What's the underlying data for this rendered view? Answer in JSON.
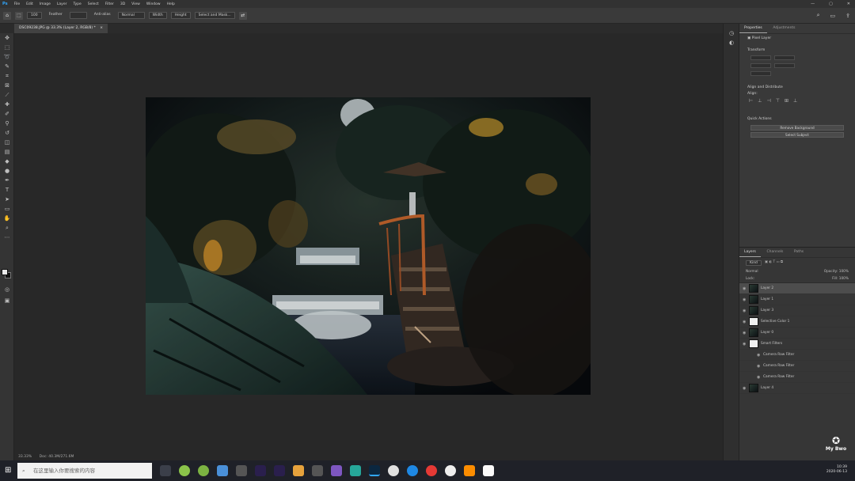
{
  "app": {
    "name": "Adobe Photoshop"
  },
  "menu": [
    "File",
    "Edit",
    "Image",
    "Layer",
    "Type",
    "Select",
    "Filter",
    "3D",
    "View",
    "Window",
    "Help"
  ],
  "options": {
    "size": "100",
    "feather": "Feather",
    "anti_alias": "Anti-alias",
    "style": "Normal",
    "width": "Width",
    "height": "Height",
    "select_mask": "Select and Mask..."
  },
  "document": {
    "tab_title": "DSC09238.JPG @ 33.3% (Layer 2, RGB/8) *"
  },
  "properties": {
    "tabs": [
      "Properties",
      "Adjustments"
    ],
    "kind": "Pixel Layer",
    "transform_label": "Transform",
    "align_label": "Align and Distribute",
    "align_sub": "Align:",
    "quick_actions_label": "Quick Actions",
    "remove_bg": "Remove Background",
    "select_subject": "Select Subject"
  },
  "layers_panel": {
    "tabs": [
      "Layers",
      "Channels",
      "Paths"
    ],
    "kind_filter": "Kind",
    "blend_mode": "Normal",
    "opacity": "Opacity: 100%",
    "lock": "Lock:",
    "fill": "Fill: 100%",
    "layers": [
      {
        "name": "Layer 2",
        "thumb": "photo",
        "selected": true
      },
      {
        "name": "Layer 1",
        "thumb": "photo",
        "selected": false
      },
      {
        "name": "Layer 3",
        "thumb": "photo",
        "selected": false
      },
      {
        "name": "Selective Color 1",
        "thumb": "white",
        "selected": false
      },
      {
        "name": "Layer 0",
        "thumb": "photo",
        "selected": false
      },
      {
        "name": "Smart Filters",
        "thumb": "white",
        "selected": false
      },
      {
        "name": "Camera Raw Filter",
        "thumb": "none",
        "selected": false
      },
      {
        "name": "Camera Raw Filter",
        "thumb": "none",
        "selected": false
      },
      {
        "name": "Camera Raw Filter",
        "thumb": "none",
        "selected": false
      },
      {
        "name": "Layer 4",
        "thumb": "photo",
        "selected": false
      }
    ]
  },
  "status_bar": {
    "zoom": "33.33%",
    "doc_info": "Doc: 40.3M/271.6M"
  },
  "taskbar": {
    "search_placeholder": "在这里输入你要搜索的内容",
    "time": "10:39",
    "date": "2020-06-13"
  },
  "watermark": {
    "text": "My Bwo"
  },
  "colors": {
    "panel_bg": "#393939",
    "canvas_bg": "#282828",
    "accent": "#31a8ff"
  }
}
